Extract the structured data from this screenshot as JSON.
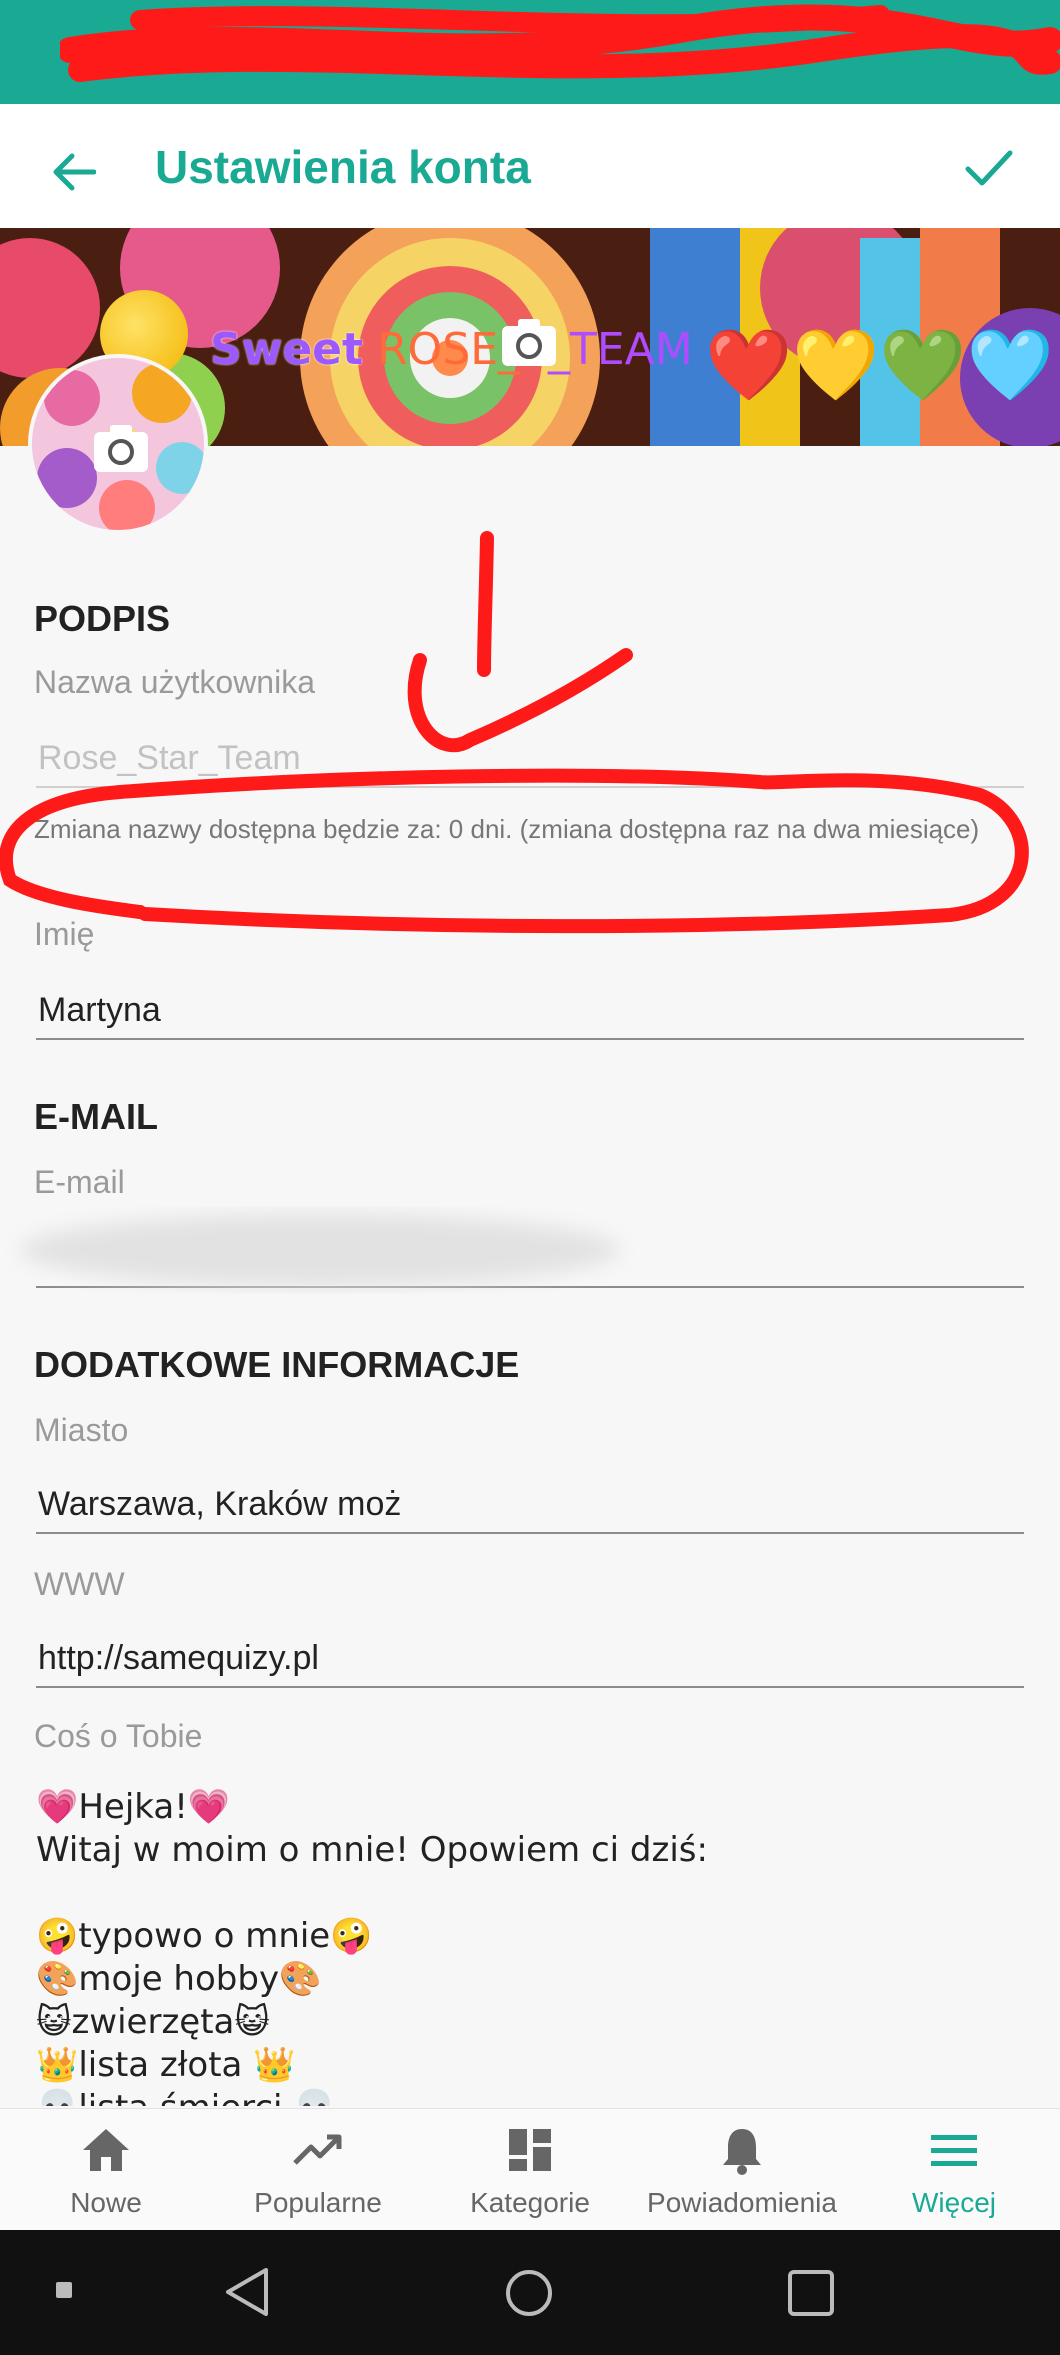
{
  "app_bar": {
    "title": "Ustawienia konta"
  },
  "cover": {
    "title_sweet": "Sweet",
    "title_rose": "ROSE_S",
    "title_team": "_TEAM",
    "hearts": "❤️💛💚🩵"
  },
  "signature_section": {
    "heading": "PODPIS",
    "username_label": "Nazwa użytkownika",
    "username_value": "Rose_Star_Team",
    "username_help": "Zmiana nazwy dostępna będzie za: 0 dni. (zmiana dostępna raz na dwa miesiące)",
    "name_label": "Imię",
    "name_value": "Martyna"
  },
  "email_section": {
    "heading": "E-MAIL",
    "email_label": "E-mail",
    "email_value": ""
  },
  "extra_section": {
    "heading": "DODATKOWE INFORMACJE",
    "city_label": "Miasto",
    "city_value": "Warszawa, Kraków moż",
    "www_label": "WWW",
    "www_value": "http://samequizy.pl",
    "about_label": "Coś o Tobie",
    "about_lines": [
      "💗Hejka!💗",
      "Witaj w moim o mnie! Opowiem ci dziś:",
      "",
      "🤪typowo o mnie🤪",
      "🎨moje hobby🎨",
      "😺zwierzęta😺",
      "👑lista złota 👑",
      "💀lista śmierci 💀"
    ]
  },
  "bottom_nav": [
    {
      "label": "Nowe",
      "icon": "home-icon",
      "active": false
    },
    {
      "label": "Popularne",
      "icon": "trending-up-icon",
      "active": false
    },
    {
      "label": "Kategorie",
      "icon": "dashboard-icon",
      "active": false
    },
    {
      "label": "Powiadomienia",
      "icon": "bell-icon",
      "active": false
    },
    {
      "label": "Więcej",
      "icon": "menu-icon",
      "active": true
    }
  ],
  "colors": {
    "accent": "#1aaa94",
    "annotation": "#ff1a1a"
  }
}
